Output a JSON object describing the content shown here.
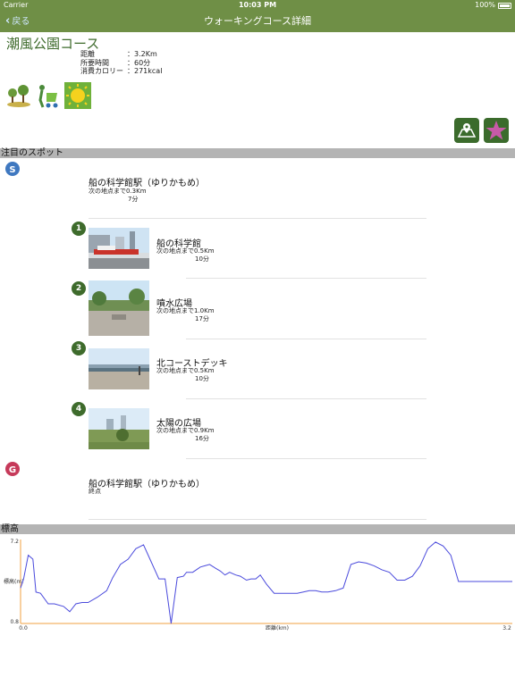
{
  "status_bar": {
    "carrier": "Carrier",
    "time": "10:03 PM",
    "battery": "100%"
  },
  "nav": {
    "back_label": "戻る",
    "title": "ウォーキングコース詳細"
  },
  "course": {
    "name": "潮風公園コース",
    "info": [
      {
        "label": "距離",
        "value": "3.2Km"
      },
      {
        "label": "所要時間",
        "value": "60分"
      },
      {
        "label": "消費カロリー",
        "value": "271kcal"
      }
    ]
  },
  "attribute_icons": [
    "park-icon",
    "stroller-icon",
    "sun-icon"
  ],
  "actions": {
    "map_icon": "map-icon",
    "favorite_icon": "star-icon"
  },
  "spots_section": {
    "header": "注目のスポット",
    "start": {
      "badge": "S",
      "name": "船の科学館駅（ゆりかもめ）",
      "next": "次の地点まで0.3Km",
      "time": "7分"
    },
    "spots": [
      {
        "number": "1",
        "name": "船の科学館",
        "next": "次の地点まで0.5Km",
        "time": "10分"
      },
      {
        "number": "2",
        "name": "噴水広場",
        "next": "次の地点まで1.0Km",
        "time": "17分"
      },
      {
        "number": "3",
        "name": "北コーストデッキ",
        "next": "次の地点まで0.5Km",
        "time": "10分"
      },
      {
        "number": "4",
        "name": "太陽の広場",
        "next": "次の地点まで0.9Km",
        "time": "16分"
      }
    ],
    "goal": {
      "badge": "G",
      "name": "船の科学館駅（ゆりかもめ）",
      "note": "終点"
    }
  },
  "elevation_section": {
    "header": "標高"
  },
  "colors": {
    "header_green": "#6f8f46",
    "spot_green": "#3e6b2c",
    "start_blue": "#3f78c0",
    "goal_red": "#c63a5a",
    "chart_line": "#4a4adc",
    "axis_orange": "#f0a040"
  },
  "chart_data": {
    "type": "line",
    "ylabel": "標高(m)",
    "xlabel": "距離(km)",
    "ylim": [
      0.8,
      7.2
    ],
    "xlim": [
      0.0,
      3.2
    ],
    "y_ticks": [
      "7.2",
      "0.8"
    ],
    "x_ticks": [
      "0.0",
      "3.2"
    ],
    "series": [
      {
        "x": [
          0.0,
          0.02,
          0.05,
          0.08,
          0.1,
          0.13,
          0.18,
          0.22,
          0.28,
          0.32,
          0.36,
          0.4,
          0.44,
          0.5,
          0.56,
          0.6,
          0.65,
          0.7,
          0.75,
          0.8,
          0.85,
          0.9,
          0.94,
          0.98,
          1.02,
          1.06,
          1.08,
          1.12,
          1.17,
          1.2,
          1.23,
          1.27,
          1.3,
          1.33,
          1.36,
          1.4,
          1.43,
          1.47,
          1.5,
          1.53,
          1.56,
          1.6,
          1.65,
          1.7,
          1.75,
          1.8,
          1.84,
          1.88,
          1.92,
          1.96,
          2.0,
          2.05,
          2.1,
          2.15,
          2.2,
          2.25,
          2.3,
          2.35,
          2.4,
          2.45,
          2.5,
          2.55,
          2.6,
          2.65,
          2.7,
          2.75,
          2.8,
          2.85,
          2.9,
          2.95,
          3.0,
          3.05,
          3.08,
          3.11,
          3.14,
          3.17,
          3.2
        ],
        "y": [
          3.5,
          4.2,
          6.0,
          5.7,
          3.2,
          3.1,
          2.3,
          2.3,
          2.1,
          1.7,
          2.3,
          2.4,
          2.4,
          2.8,
          3.3,
          4.3,
          5.3,
          5.7,
          6.5,
          6.8,
          5.5,
          4.2,
          4.2,
          0.8,
          4.3,
          4.4,
          4.7,
          4.7,
          5.1,
          5.2,
          5.3,
          5.0,
          4.8,
          4.5,
          4.7,
          4.5,
          4.4,
          4.1,
          4.2,
          4.2,
          4.5,
          3.8,
          3.1,
          3.1,
          3.1,
          3.1,
          3.2,
          3.3,
          3.3,
          3.2,
          3.2,
          3.3,
          3.5,
          5.3,
          5.5,
          5.4,
          5.2,
          4.9,
          4.7,
          4.1,
          4.1,
          4.4,
          5.2,
          6.5,
          7.0,
          6.7,
          6.0,
          4.0,
          4.0,
          4.0,
          4.0,
          4.0,
          4.0,
          4.0,
          4.0,
          4.0,
          4.0
        ]
      }
    ]
  }
}
